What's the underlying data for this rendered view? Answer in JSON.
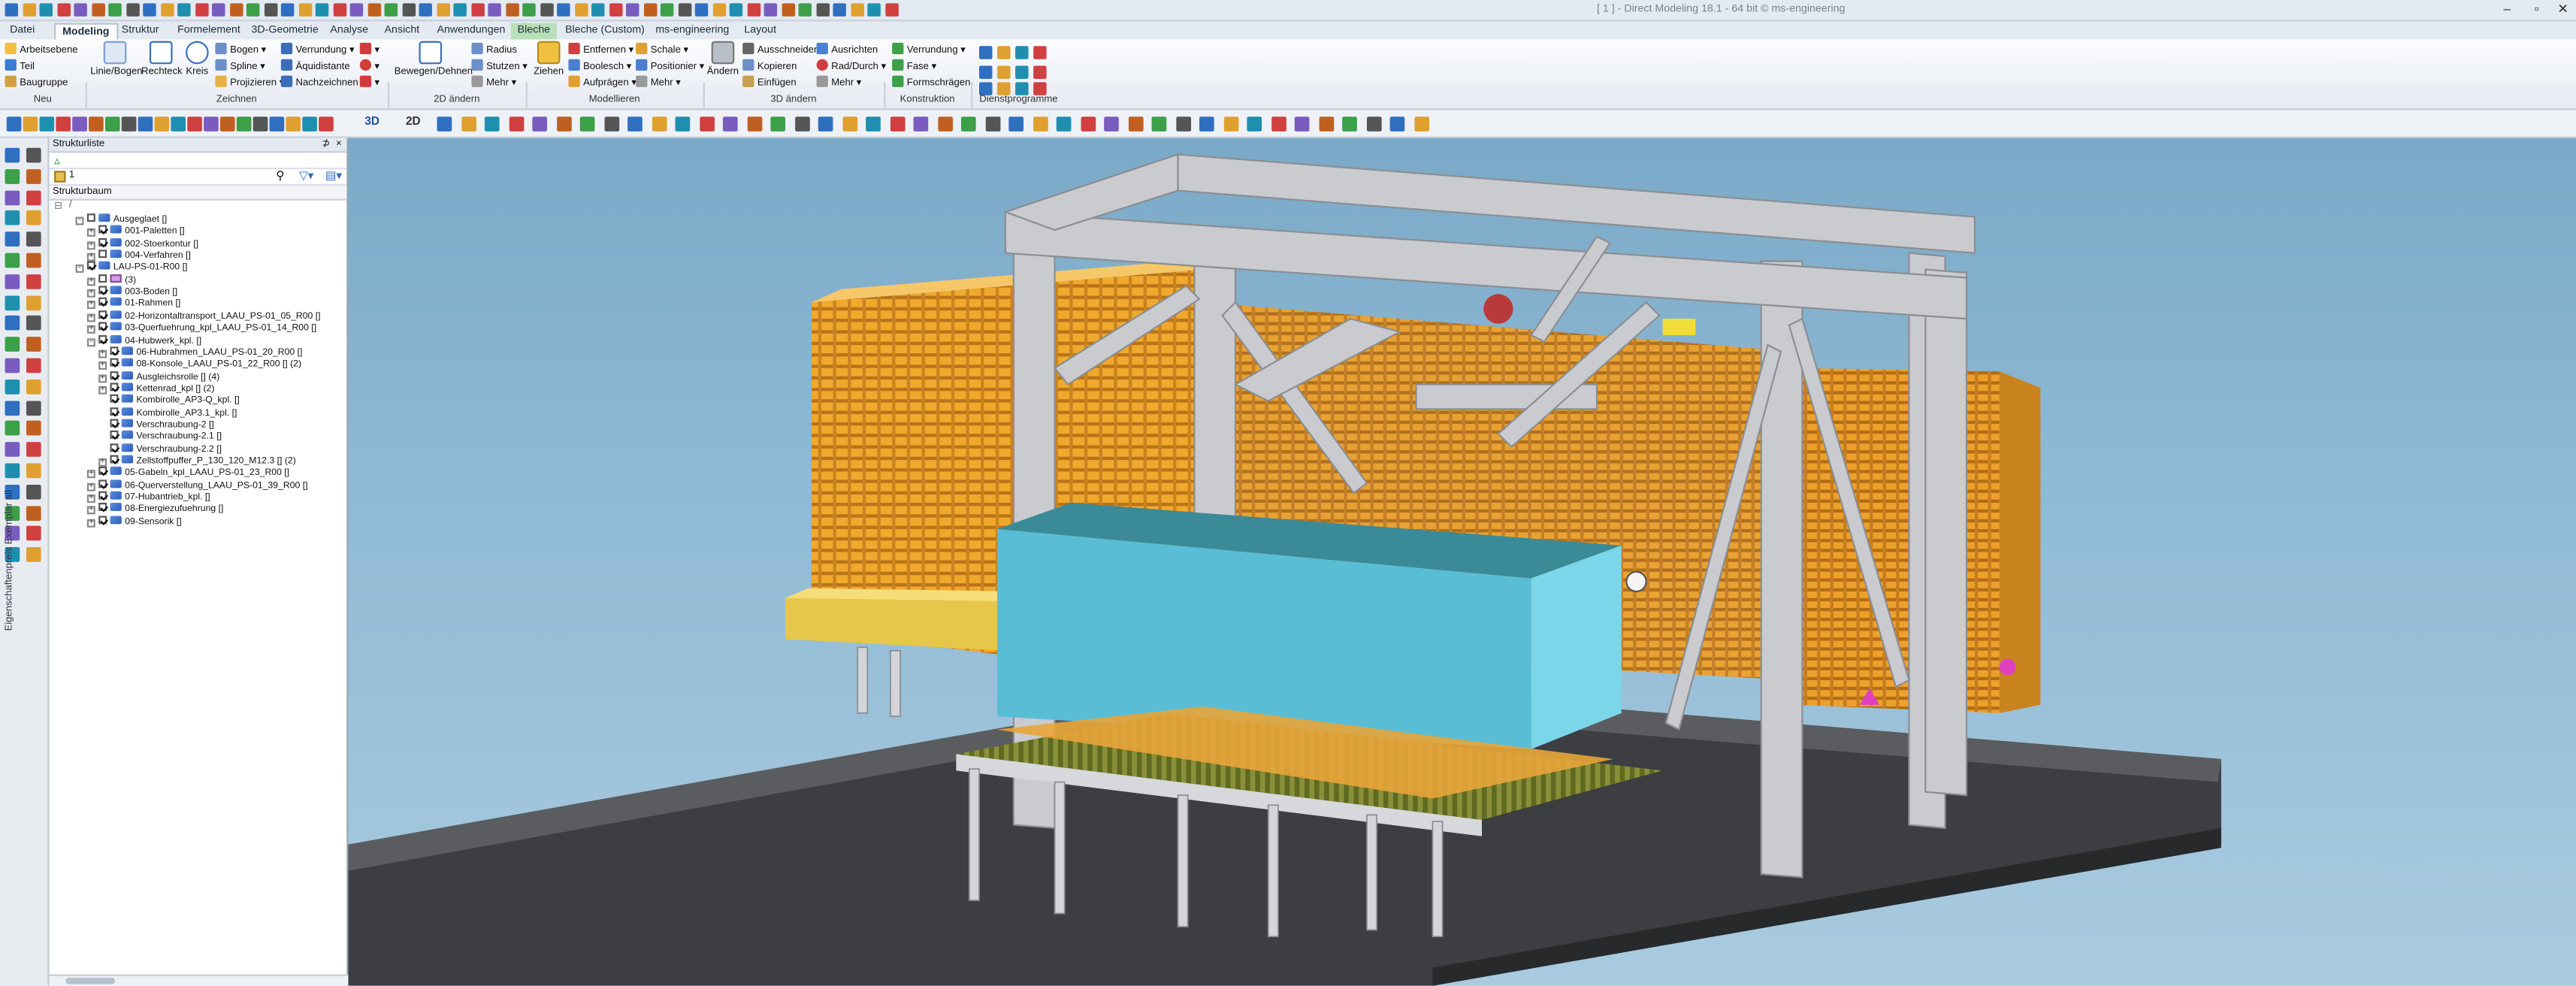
{
  "window": {
    "title": "[ 1 ] - Direct Modeling 18.1 - 64 bit © ms-engineering"
  },
  "tabs": [
    "Datei",
    "Modeling",
    "Struktur",
    "Formelement",
    "3D-Geometrie",
    "Analyse",
    "Ansicht",
    "Anwendungen",
    "Bleche",
    "Bleche (Custom)",
    "ms-engineering",
    "Layout"
  ],
  "ribbon": {
    "neu": [
      "Arbeitsebene",
      "Teil",
      "Baugruppe"
    ],
    "zeichnen_big": [
      "Linie/Bogen",
      "Rechteck",
      "Kreis"
    ],
    "zeichnen_small": [
      "Bogen",
      "Spline",
      "Projizieren",
      "Verrundung",
      "Äquidistante",
      "Nachzeichnen"
    ],
    "aendern_2d": [
      "Bewegen/Dehnen",
      "Radius",
      "Stutzen",
      "Mehr"
    ],
    "modellieren_big": [
      "Ziehen"
    ],
    "modellieren_small": [
      "Entfernen",
      "Boolesch",
      "Aufprägen",
      "Schale",
      "Positionier",
      "Mehr"
    ],
    "aendern_3d_big": [
      "Ändern"
    ],
    "aendern_3d_small": [
      "Ausschneiden",
      "Kopieren",
      "Einfügen",
      "Ausrichten",
      "Rad/Durch",
      "Mehr"
    ],
    "konstruktion": [
      "Verrundung",
      "Fase",
      "Formschrägen"
    ],
    "groups": [
      "Neu",
      "Zeichnen",
      "2D ändern",
      "Modellieren",
      "3D ändern",
      "Konstruktion",
      "Dienstprogramme"
    ]
  },
  "toolbar": {
    "view_3d": "3D",
    "view_2d": "2D"
  },
  "tree": {
    "panel_title": "Strukturliste",
    "pin": "1",
    "header": "Strukturbaum",
    "items": [
      {
        "text": "Ausgeglaet []",
        "depth": 2,
        "exp": "-",
        "cb": false,
        "icon": "doc"
      },
      {
        "text": "001-Paletten []",
        "depth": 3,
        "exp": "+",
        "cb": true,
        "icon": "asm"
      },
      {
        "text": "002-Stoerkontur []",
        "depth": 3,
        "exp": "+",
        "cb": true,
        "icon": "asm"
      },
      {
        "text": "004-Verfahren []",
        "depth": 3,
        "exp": "+",
        "cb": false,
        "icon": "asm"
      },
      {
        "text": "LAU-PS-01-R00 []",
        "depth": 2,
        "exp": "-",
        "cb": true,
        "icon": "asm"
      },
      {
        "text": "(3)",
        "depth": 3,
        "exp": "+",
        "cb": false,
        "icon": "folder"
      },
      {
        "text": "003-Boden []",
        "depth": 3,
        "exp": "+",
        "cb": true,
        "icon": "asm"
      },
      {
        "text": "01-Rahmen []",
        "depth": 3,
        "exp": "+",
        "cb": true,
        "icon": "asm"
      },
      {
        "text": "02-Horizontaltransport_LAAU_PS-01_05_R00 []",
        "depth": 3,
        "exp": "+",
        "cb": true,
        "icon": "asm"
      },
      {
        "text": "03-Querfuehrung_kpl_LAAU_PS-01_14_R00 []",
        "depth": 3,
        "exp": "+",
        "cb": true,
        "icon": "asm"
      },
      {
        "text": "04-Hubwerk_kpl. []",
        "depth": 3,
        "exp": "-",
        "cb": true,
        "icon": "asm"
      },
      {
        "text": "06-Hubrahmen_LAAU_PS-01_20_R00 []",
        "depth": 4,
        "exp": "+",
        "cb": true,
        "icon": "asm"
      },
      {
        "text": "08-Konsole_LAAU_PS-01_22_R00 [] (2)",
        "depth": 4,
        "exp": "+",
        "cb": true,
        "icon": "asm"
      },
      {
        "text": "Ausgleichsrolle [] (4)",
        "depth": 4,
        "exp": "+",
        "cb": true,
        "icon": "asm"
      },
      {
        "text": "Kettenrad_kpl [] (2)",
        "depth": 4,
        "exp": "+",
        "cb": true,
        "icon": "asm"
      },
      {
        "text": "Kombirolle_AP3-Q_kpl. []",
        "depth": 4,
        "exp": "",
        "cb": true,
        "icon": "asm"
      },
      {
        "text": "Kombirolle_AP3.1_kpl. []",
        "depth": 4,
        "exp": "",
        "cb": true,
        "icon": "asm"
      },
      {
        "text": "Verschraubung-2 []",
        "depth": 4,
        "exp": "",
        "cb": true,
        "icon": "asm"
      },
      {
        "text": "Verschraubung-2.1 []",
        "depth": 4,
        "exp": "",
        "cb": true,
        "icon": "asm"
      },
      {
        "text": "Verschraubung-2.2 []",
        "depth": 4,
        "exp": "",
        "cb": true,
        "icon": "asm"
      },
      {
        "text": "Zellstoffpuffer_P_130_120_M12.3 [] (2)",
        "depth": 4,
        "exp": "+",
        "cb": true,
        "icon": "asm"
      },
      {
        "text": "05-Gabeln_kpl_LAAU_PS-01_23_R00 []",
        "depth": 3,
        "exp": "+",
        "cb": true,
        "icon": "asm"
      },
      {
        "text": "06-Querverstellung_LAAU_PS-01_39_R00 []",
        "depth": 3,
        "exp": "+",
        "cb": true,
        "icon": "asm"
      },
      {
        "text": "07-Hubantrieb_kpl. []",
        "depth": 3,
        "exp": "+",
        "cb": true,
        "icon": "asm"
      },
      {
        "text": "08-Energiezufuehrung []",
        "depth": 3,
        "exp": "+",
        "cb": true,
        "icon": "asm"
      },
      {
        "text": "09-Sensorik []",
        "depth": 3,
        "exp": "+",
        "cb": true,
        "icon": "asm"
      }
    ]
  },
  "sidebar_vertical_label": "Eigenschaftenpreis Exemplar all",
  "colors": {
    "accent": "#2f6fc0",
    "bleche_tab": "#b9e0b9",
    "pallet": "#e8a12c",
    "frame": "#c7c9cc",
    "cube": "#5cc6dc",
    "floor": "#3b3d40"
  }
}
